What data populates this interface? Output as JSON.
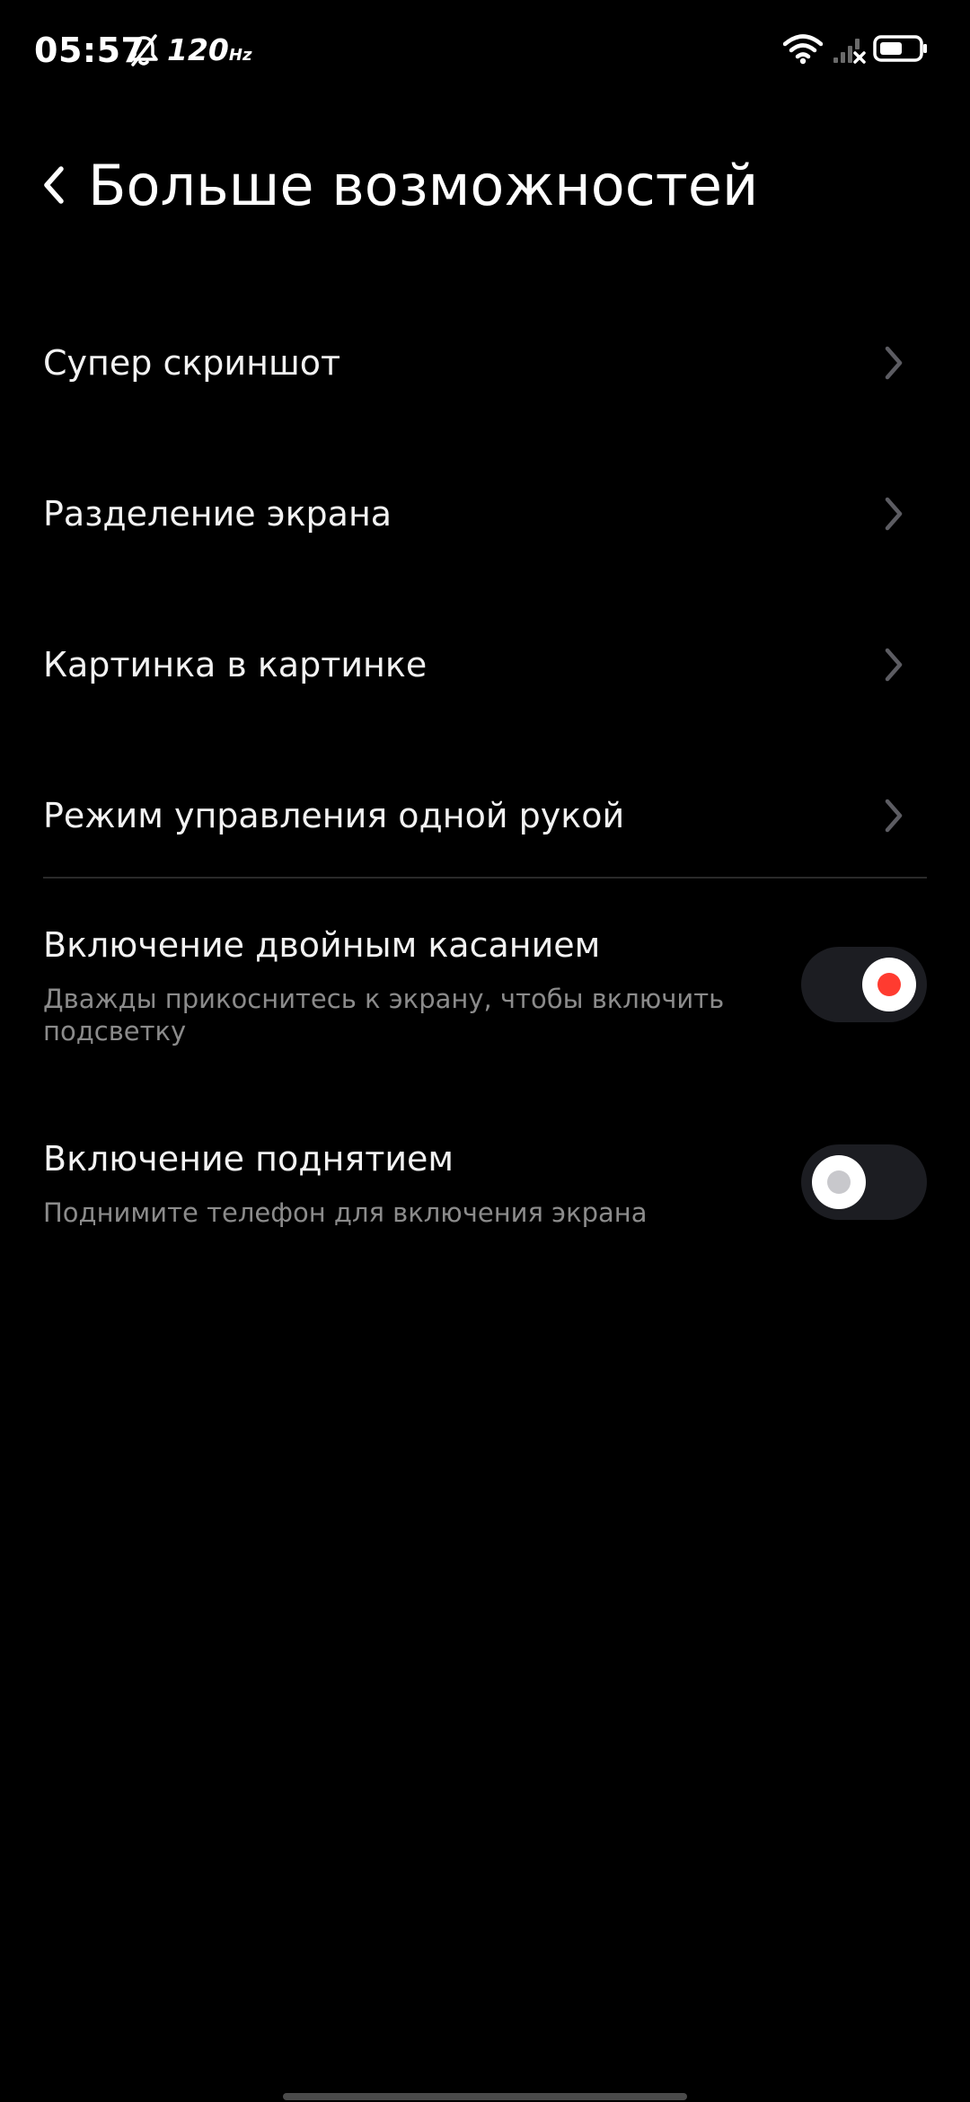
{
  "status_bar": {
    "time": "05:57",
    "refresh_rate": "120",
    "refresh_unit": "Hz",
    "icons": [
      "bell-muted-icon",
      "wifi-icon",
      "signal-off-icon",
      "battery-icon"
    ],
    "battery_level": 0.55
  },
  "header": {
    "title": "Больше возможностей",
    "back_icon": "chevron-left-icon"
  },
  "nav_items": [
    {
      "label": "Супер скриншот",
      "icon": "chevron-right-icon"
    },
    {
      "label": "Разделение экрана",
      "icon": "chevron-right-icon"
    },
    {
      "label": "Картинка в картинке",
      "icon": "chevron-right-icon"
    },
    {
      "label": "Режим управления одной рукой",
      "icon": "chevron-right-icon"
    }
  ],
  "toggles": [
    {
      "title": "Включение двойным касанием",
      "description": "Дважды прикоснитесь к экрану, чтобы включить подсветку",
      "state": "on"
    },
    {
      "title": "Включение поднятием",
      "description": "Поднимите телефон для включения экрана",
      "state": "off"
    }
  ],
  "colors": {
    "background": "#000000",
    "text_primary": "#f2f2f2",
    "text_secondary": "#8b8b8b",
    "accent_on": "#ff3b30",
    "knob_off_dot": "#c8c8cc",
    "switch_track": "#1c1d22",
    "chevron": "#5c5c62",
    "divider": "#2a2a2a"
  }
}
